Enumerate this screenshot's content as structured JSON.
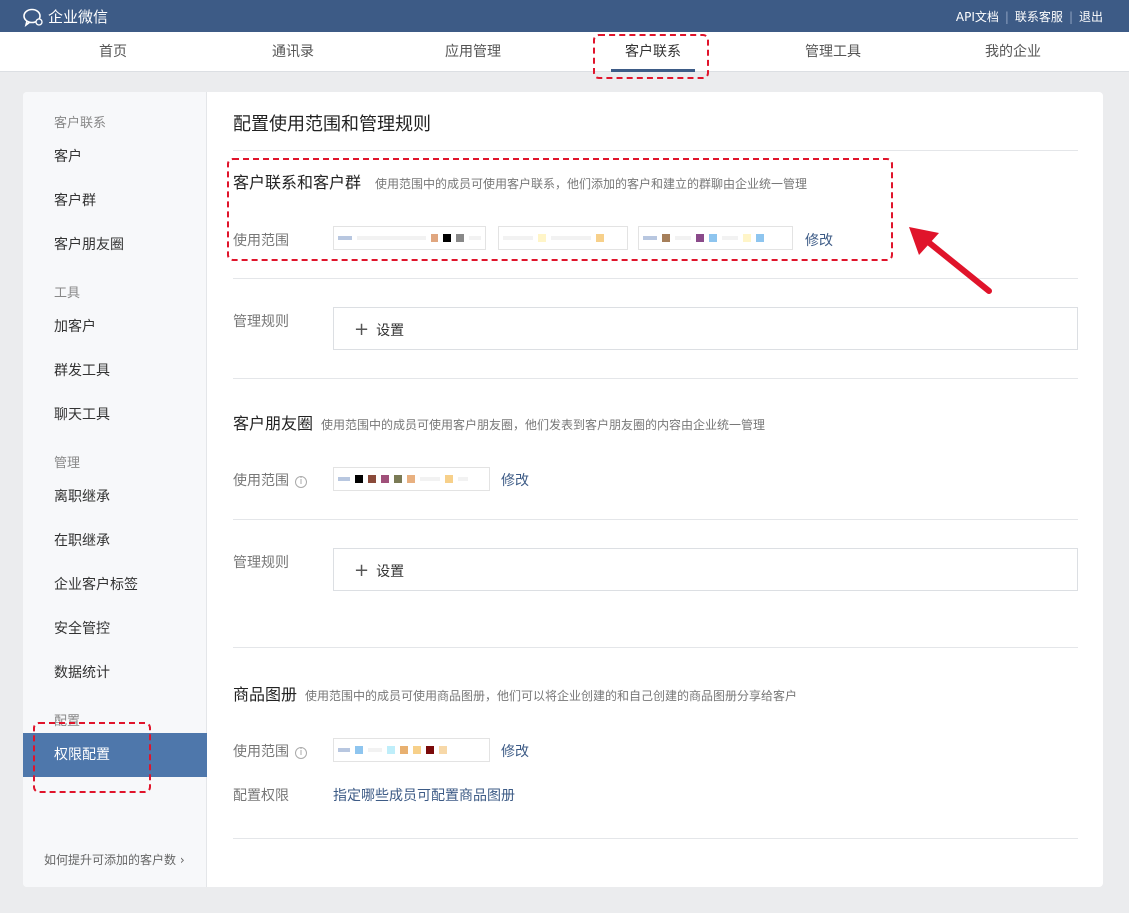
{
  "topbar": {
    "app_name": "企业微信",
    "links": [
      "API文档",
      "联系客服",
      "退出"
    ]
  },
  "nav": {
    "items": [
      "首页",
      "通讯录",
      "应用管理",
      "客户联系",
      "管理工具",
      "我的企业"
    ],
    "active": "客户联系"
  },
  "sidebar": {
    "group_customer": "客户联系",
    "customer": "客户",
    "customer_group": "客户群",
    "moments": "客户朋友圈",
    "group_tools": "工具",
    "add_customer": "加客户",
    "mass_send": "群发工具",
    "chat_tools": "聊天工具",
    "group_manage": "管理",
    "resign_inherit": "离职继承",
    "onjob_inherit": "在职继承",
    "customer_tags": "企业客户标签",
    "security": "安全管控",
    "stats": "数据统计",
    "group_config": "配置",
    "permission_config": "权限配置",
    "footer_link": "如何提升可添加的客户数"
  },
  "main": {
    "page_title": "配置使用范围和管理规则",
    "sections": {
      "contact": {
        "title": "客户联系和客户群",
        "desc": "使用范围中的成员可使用客户联系，他们添加的客户和建立的群聊由企业统一管理",
        "scope_label": "使用范围",
        "edit": "修改",
        "rules_label": "管理规则",
        "set": "设置"
      },
      "moments": {
        "title": "客户朋友圈",
        "desc": "使用范围中的成员可使用客户朋友圈，他们发表到客户朋友圈的内容由企业统一管理",
        "scope_label": "使用范围",
        "edit": "修改",
        "rules_label": "管理规则",
        "set": "设置"
      },
      "catalog": {
        "title": "商品图册",
        "desc": "使用范围中的成员可使用商品图册，他们可以将企业创建的和自己创建的商品图册分享给客户",
        "scope_label": "使用范围",
        "edit": "修改",
        "config_label": "配置权限",
        "config_link": "指定哪些成员可配置商品图册"
      }
    }
  },
  "colors": {
    "topbar": "#3d5b86",
    "active_sidebar": "#4e77ab",
    "annotation_red": "#e0142b",
    "link": "#3d5b86"
  },
  "icons": [
    "wechat-work-logo-icon",
    "info-icon",
    "plus-icon",
    "chevron-right-icon",
    "red-arrow-annotation-icon"
  ]
}
